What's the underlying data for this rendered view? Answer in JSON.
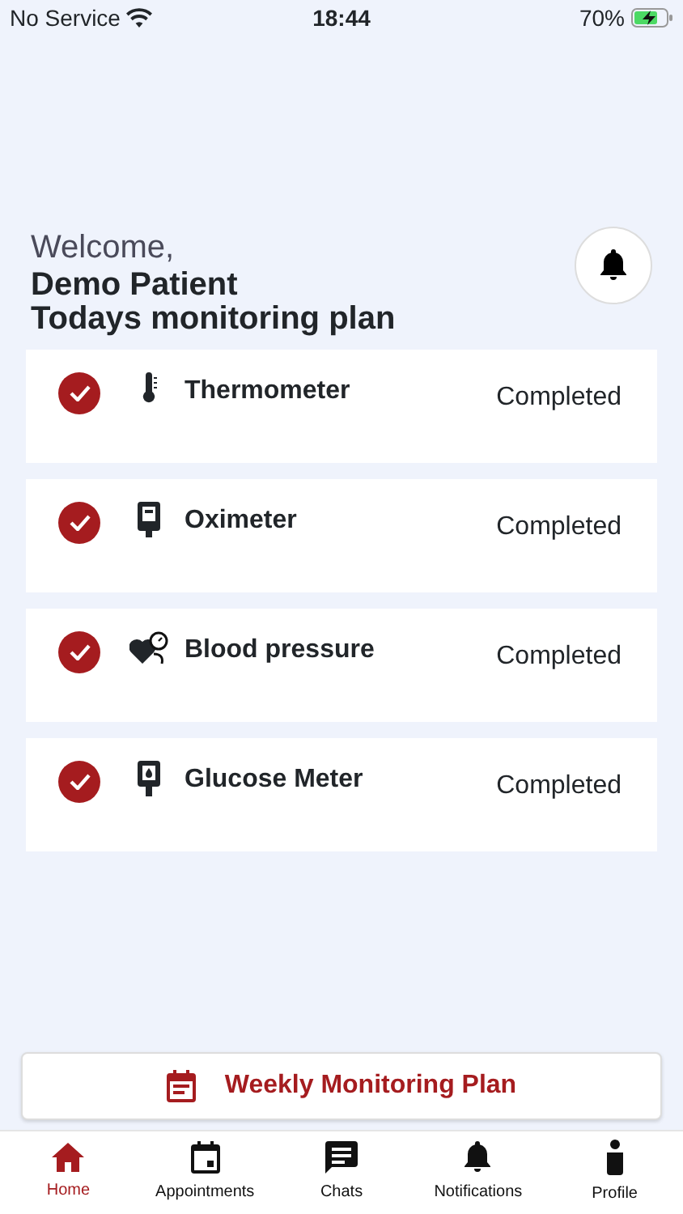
{
  "status_bar": {
    "carrier": "No Service",
    "time": "18:44",
    "battery": "70%"
  },
  "greeting": "Welcome,",
  "user_name": "Demo Patient",
  "section_title": "Todays monitoring plan",
  "plan_items": [
    {
      "kind": "thermometer",
      "name": "Thermometer",
      "status": "Completed",
      "checked": true
    },
    {
      "kind": "oximeter",
      "name": "Oximeter",
      "status": "Completed",
      "checked": true
    },
    {
      "kind": "blood-pressure",
      "name": "Blood pressure",
      "status": "Completed",
      "checked": true
    },
    {
      "kind": "glucose-meter",
      "name": "Glucose Meter",
      "status": "Completed",
      "checked": true
    }
  ],
  "weekly_button": "Weekly Monitoring Plan",
  "tabs": [
    {
      "kind": "home",
      "label": "Home",
      "selected": true
    },
    {
      "kind": "appointments",
      "label": "Appointments",
      "selected": false
    },
    {
      "kind": "chats",
      "label": "Chats",
      "selected": false
    },
    {
      "kind": "notifications",
      "label": "Notifications",
      "selected": false
    },
    {
      "kind": "profile",
      "label": "Profile",
      "selected": false
    }
  ]
}
